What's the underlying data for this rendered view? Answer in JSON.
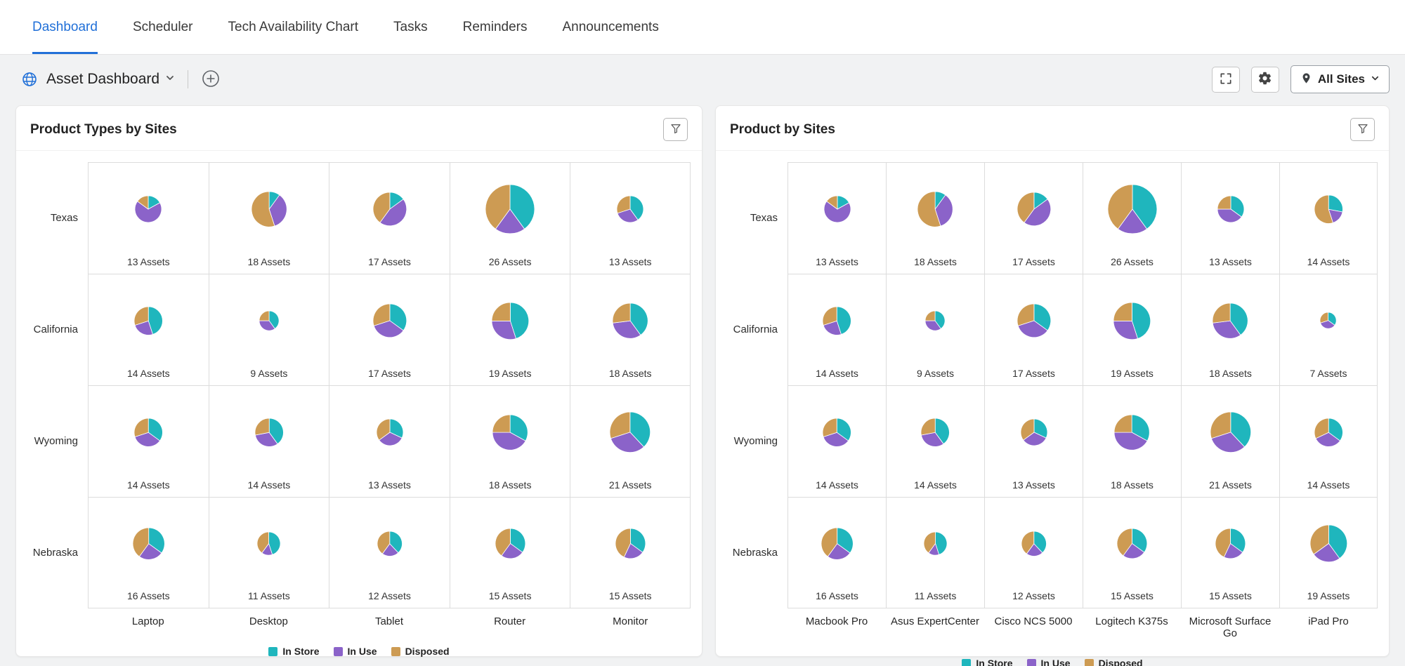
{
  "colors": {
    "accent": "#2170d8",
    "grid_line": "#dcdcdc"
  },
  "nav": {
    "tabs": [
      {
        "label": "Dashboard",
        "active": true
      },
      {
        "label": "Scheduler",
        "active": false
      },
      {
        "label": "Tech Availability Chart",
        "active": false
      },
      {
        "label": "Tasks",
        "active": false
      },
      {
        "label": "Reminders",
        "active": false
      },
      {
        "label": "Announcements",
        "active": false
      }
    ]
  },
  "toolbar": {
    "dashboard_title": "Asset Dashboard",
    "dashboard_selector_icons": [
      "globe-icon",
      "chevron-down-icon"
    ],
    "add_button_icon": "plus-circle-icon",
    "fullscreen_icon": "fullscreen-icon",
    "settings_icon": "gear-icon",
    "site_filter_label": "All Sites",
    "site_filter_icons": [
      "location-pin-icon",
      "chevron-down-icon"
    ]
  },
  "legend": [
    {
      "label": "In Store",
      "color": "#1fb6bd"
    },
    {
      "label": "In Use",
      "color": "#8b63c9"
    },
    {
      "label": "Disposed",
      "color": "#cd9b53"
    }
  ],
  "chart_data": [
    {
      "type": "pie-matrix",
      "title": "Product Types by Sites",
      "rows": [
        "Texas",
        "California",
        "Wyoming",
        "Nebraska"
      ],
      "columns": [
        "Laptop",
        "Desktop",
        "Tablet",
        "Router",
        "Monitor"
      ],
      "series_names": [
        "In Store",
        "In Use",
        "Disposed"
      ],
      "count_label_suffix": "Assets",
      "legend_position": "bottom",
      "size_note": "pie diameter proportional to asset count",
      "cells": [
        [
          {
            "count": 13,
            "fractions": [
              0.17,
              0.68,
              0.15
            ]
          },
          {
            "count": 18,
            "fractions": [
              0.1,
              0.35,
              0.55
            ]
          },
          {
            "count": 17,
            "fractions": [
              0.15,
              0.45,
              0.4
            ]
          },
          {
            "count": 26,
            "fractions": [
              0.4,
              0.2,
              0.4
            ]
          },
          {
            "count": 13,
            "fractions": [
              0.4,
              0.3,
              0.3
            ]
          }
        ],
        [
          {
            "count": 14,
            "fractions": [
              0.45,
              0.25,
              0.3
            ]
          },
          {
            "count": 9,
            "fractions": [
              0.4,
              0.35,
              0.25
            ]
          },
          {
            "count": 17,
            "fractions": [
              0.35,
              0.35,
              0.3
            ]
          },
          {
            "count": 19,
            "fractions": [
              0.45,
              0.3,
              0.25
            ]
          },
          {
            "count": 18,
            "fractions": [
              0.4,
              0.33,
              0.27
            ]
          }
        ],
        [
          {
            "count": 14,
            "fractions": [
              0.35,
              0.35,
              0.3
            ]
          },
          {
            "count": 14,
            "fractions": [
              0.4,
              0.32,
              0.28
            ]
          },
          {
            "count": 13,
            "fractions": [
              0.32,
              0.33,
              0.35
            ]
          },
          {
            "count": 18,
            "fractions": [
              0.33,
              0.42,
              0.25
            ]
          },
          {
            "count": 21,
            "fractions": [
              0.38,
              0.32,
              0.3
            ]
          }
        ],
        [
          {
            "count": 16,
            "fractions": [
              0.35,
              0.25,
              0.4
            ]
          },
          {
            "count": 11,
            "fractions": [
              0.45,
              0.15,
              0.4
            ]
          },
          {
            "count": 12,
            "fractions": [
              0.38,
              0.22,
              0.4
            ]
          },
          {
            "count": 15,
            "fractions": [
              0.35,
              0.25,
              0.4
            ]
          },
          {
            "count": 15,
            "fractions": [
              0.35,
              0.22,
              0.43
            ]
          }
        ]
      ]
    },
    {
      "type": "pie-matrix",
      "title": "Product by Sites",
      "rows": [
        "Texas",
        "California",
        "Wyoming",
        "Nebraska"
      ],
      "columns": [
        "Macbook Pro",
        "Asus ExpertCenter",
        "Cisco NCS 5000",
        "Logitech K375s",
        "Microsoft Surface Go",
        "iPad Pro"
      ],
      "series_names": [
        "In Store",
        "In Use",
        "Disposed"
      ],
      "count_label_suffix": "Assets",
      "legend_position": "bottom",
      "size_note": "pie diameter proportional to asset count",
      "cells": [
        [
          {
            "count": 13,
            "fractions": [
              0.17,
              0.68,
              0.15
            ]
          },
          {
            "count": 18,
            "fractions": [
              0.1,
              0.35,
              0.55
            ]
          },
          {
            "count": 17,
            "fractions": [
              0.15,
              0.45,
              0.4
            ]
          },
          {
            "count": 26,
            "fractions": [
              0.4,
              0.2,
              0.4
            ]
          },
          {
            "count": 13,
            "fractions": [
              0.35,
              0.4,
              0.25
            ]
          },
          {
            "count": 14,
            "fractions": [
              0.28,
              0.17,
              0.55
            ]
          }
        ],
        [
          {
            "count": 14,
            "fractions": [
              0.45,
              0.25,
              0.3
            ]
          },
          {
            "count": 9,
            "fractions": [
              0.4,
              0.35,
              0.25
            ]
          },
          {
            "count": 17,
            "fractions": [
              0.35,
              0.35,
              0.3
            ]
          },
          {
            "count": 19,
            "fractions": [
              0.45,
              0.3,
              0.25
            ]
          },
          {
            "count": 18,
            "fractions": [
              0.4,
              0.33,
              0.27
            ]
          },
          {
            "count": 7,
            "fractions": [
              0.35,
              0.35,
              0.3
            ]
          }
        ],
        [
          {
            "count": 14,
            "fractions": [
              0.35,
              0.35,
              0.3
            ]
          },
          {
            "count": 14,
            "fractions": [
              0.4,
              0.32,
              0.28
            ]
          },
          {
            "count": 13,
            "fractions": [
              0.32,
              0.33,
              0.35
            ]
          },
          {
            "count": 18,
            "fractions": [
              0.33,
              0.42,
              0.25
            ]
          },
          {
            "count": 21,
            "fractions": [
              0.38,
              0.32,
              0.3
            ]
          },
          {
            "count": 14,
            "fractions": [
              0.35,
              0.33,
              0.32
            ]
          }
        ],
        [
          {
            "count": 16,
            "fractions": [
              0.35,
              0.25,
              0.4
            ]
          },
          {
            "count": 11,
            "fractions": [
              0.45,
              0.15,
              0.4
            ]
          },
          {
            "count": 12,
            "fractions": [
              0.38,
              0.22,
              0.4
            ]
          },
          {
            "count": 15,
            "fractions": [
              0.35,
              0.25,
              0.4
            ]
          },
          {
            "count": 15,
            "fractions": [
              0.35,
              0.22,
              0.43
            ]
          },
          {
            "count": 19,
            "fractions": [
              0.4,
              0.25,
              0.35
            ]
          }
        ]
      ]
    }
  ]
}
